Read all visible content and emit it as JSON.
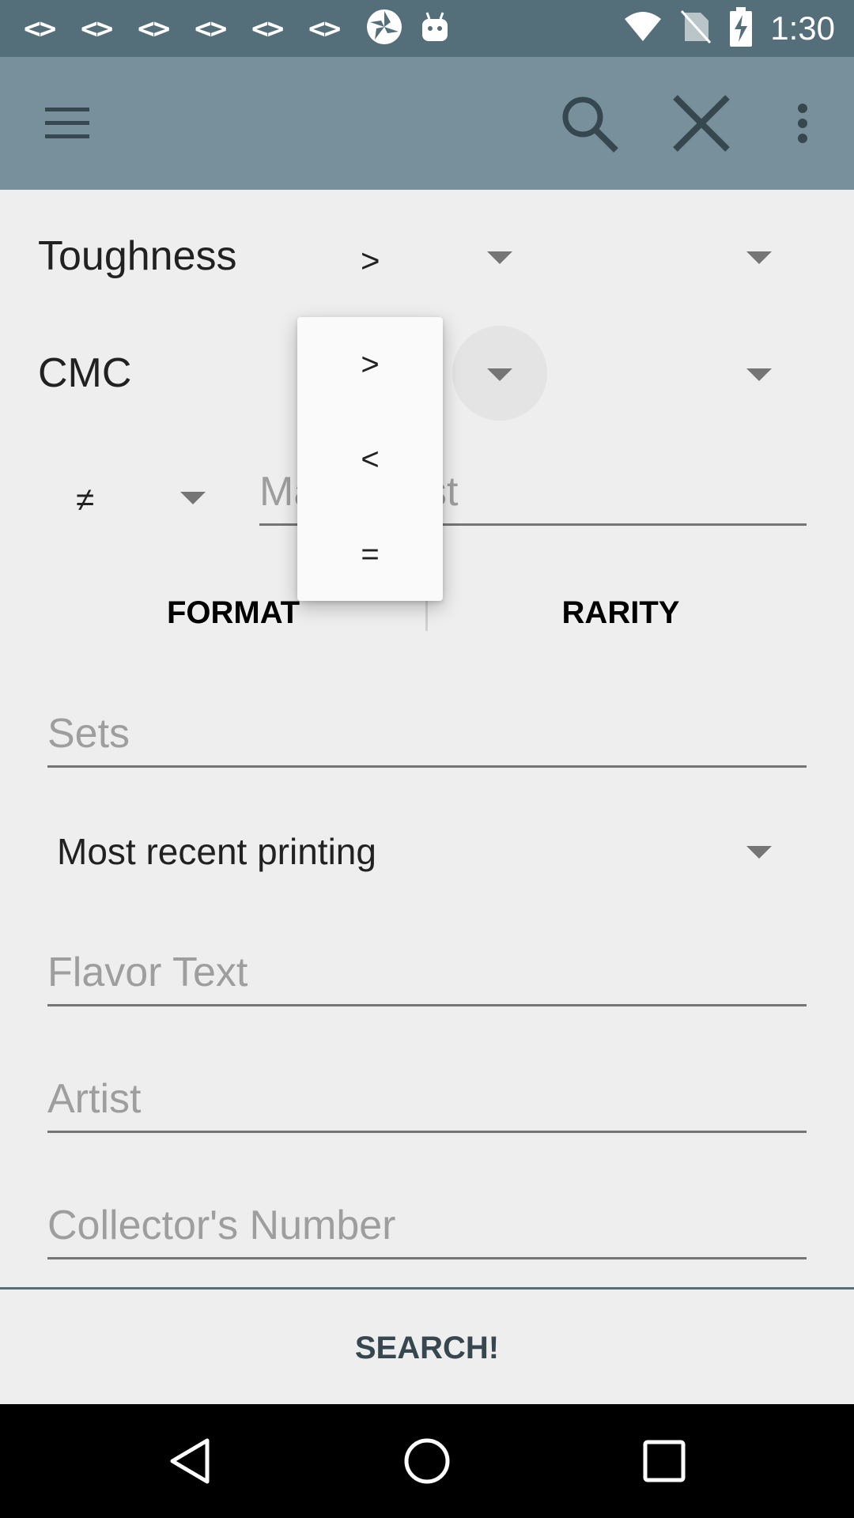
{
  "status_bar": {
    "notifications": [
      "<>",
      "<>",
      "<>",
      "<>",
      "<>",
      "<>"
    ],
    "icons": [
      "pinwheel-icon",
      "android-icon",
      "wifi-icon",
      "no-sim-icon",
      "battery-charging-icon"
    ],
    "time": "1:30"
  },
  "toolbar": {
    "icons": [
      "menu-icon",
      "search-icon",
      "close-icon",
      "more-vert-icon"
    ],
    "color": "#78909c"
  },
  "form": {
    "toughness": {
      "label": "Toughness",
      "operator": ">"
    },
    "cmc": {
      "label": "CMC"
    },
    "mana_cost": {
      "operator": "≠",
      "placeholder": "Mana Cost"
    },
    "format_button": "FORMAT",
    "rarity_button": "RARITY",
    "sets_placeholder": "Sets",
    "printing_select": "Most recent printing",
    "flavor_placeholder": "Flavor Text",
    "artist_placeholder": "Artist",
    "collector_placeholder": "Collector's Number",
    "search_button": "SEARCH!"
  },
  "dropdown_menu": {
    "options": [
      ">",
      "<",
      "="
    ]
  },
  "nav_bar": {
    "icons": [
      "back-icon",
      "home-icon",
      "recents-icon"
    ]
  }
}
